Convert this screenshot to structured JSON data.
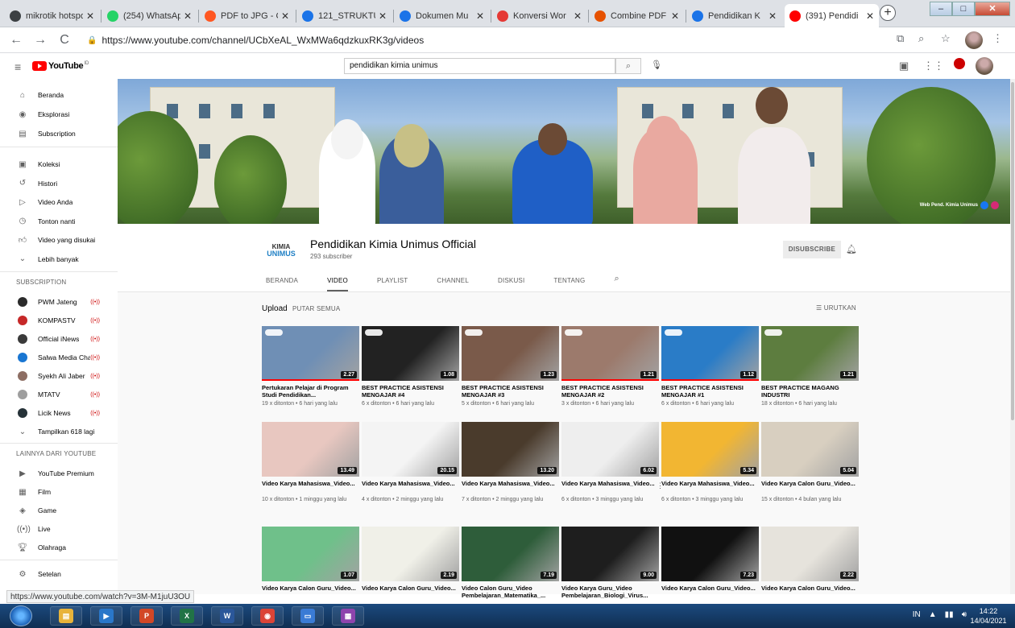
{
  "browser": {
    "tabs": [
      {
        "label": "mikrotik hotspot",
        "color": "#3c4043",
        "active": false
      },
      {
        "label": "(254) WhatsApp",
        "color": "#25d366",
        "active": false
      },
      {
        "label": "PDF to JPG - C",
        "color": "#ff5722",
        "active": false
      },
      {
        "label": "121_STRUKTUR",
        "color": "#1a73e8",
        "active": false
      },
      {
        "label": "Dokumen Mu",
        "color": "#1a73e8",
        "active": false
      },
      {
        "label": "Konversi Wor",
        "color": "#e53935",
        "active": false
      },
      {
        "label": "Combine PDF",
        "color": "#e65100",
        "active": false
      },
      {
        "label": "Pendidikan K",
        "color": "#1a73e8",
        "active": false
      },
      {
        "label": "(391) Pendidi",
        "color": "#ff0000",
        "active": true
      }
    ],
    "url": "https://www.youtube.com/channel/UCbXeAL_WxMWa6qdzkuxRK3g/videos",
    "status_url": "https://www.youtube.com/watch?v=3M-M1juU3OU"
  },
  "masthead": {
    "logo_text": "YouTube",
    "logo_region": "ID",
    "search_value": "pendidikan kimia unimus"
  },
  "sidebar": {
    "main": [
      "Beranda",
      "Eksplorasi",
      "Subscription"
    ],
    "library": [
      "Koleksi",
      "Histori",
      "Video Anda",
      "Tonton nanti",
      "Video yang disukai",
      "Lebih banyak"
    ],
    "subscription_title": "SUBSCRIPTION",
    "subscriptions": [
      {
        "name": "PWM Jateng",
        "color": "#2b2b2b"
      },
      {
        "name": "KOMPASTV",
        "color": "#c62828"
      },
      {
        "name": "Official iNews",
        "color": "#3a3a3a"
      },
      {
        "name": "Salwa Media Chan...",
        "color": "#1976d2"
      },
      {
        "name": "Syekh Ali Jaber",
        "color": "#8d6e63"
      },
      {
        "name": "MTATV",
        "color": "#9e9e9e"
      },
      {
        "name": "Licik News",
        "color": "#263238"
      }
    ],
    "show_more": "Tampilkan 618 lagi",
    "live_badge": "((•))",
    "more_title": "LAINNYA DARI YOUTUBE",
    "more": [
      "YouTube Premium",
      "Film",
      "Game",
      "Live",
      "Olahraga"
    ],
    "settings": "Setelan"
  },
  "banner": {
    "link_text": "Web Pend. Kimia Unimus"
  },
  "channel": {
    "logo_line1": "KIMIA",
    "logo_line2": "UNIMUS",
    "name": "Pendidikan Kimia Unimus Official",
    "subscribers": "293 subscriber",
    "unsubscribe_label": "DISUBSCRIBE",
    "tabs": [
      "BERANDA",
      "VIDEO",
      "PLAYLIST",
      "CHANNEL",
      "DISKUSI",
      "TENTANG"
    ],
    "selected_tab": "VIDEO"
  },
  "uploads": {
    "title": "Upload",
    "play_all": "PUTAR SEMUA",
    "sort": "URUTKAN",
    "videos": [
      {
        "title": "Pertukaran Pelajar di Program Studi Pendidikan...",
        "meta": "19 x ditonton • 6 hari yang lalu",
        "duration": "2.27",
        "bg": "#6f8fb5",
        "progress": 100
      },
      {
        "title": "BEST PRACTICE ASISTENSI MENGAJAR #4",
        "meta": "6 x ditonton • 6 hari yang lalu",
        "duration": "1.08",
        "bg": "#222222",
        "progress": 0
      },
      {
        "title": "BEST PRACTICE ASISTENSI MENGAJAR #3",
        "meta": "5 x ditonton • 6 hari yang lalu",
        "duration": "1.23",
        "bg": "#7a5a4a",
        "progress": 0
      },
      {
        "title": "BEST PRACTICE ASISTENSI MENGAJAR #2",
        "meta": "3 x ditonton • 6 hari yang lalu",
        "duration": "1.21",
        "bg": "#9c7a6c",
        "progress": 100
      },
      {
        "title": "BEST PRACTICE ASISTENSI MENGAJAR #1",
        "meta": "6 x ditonton • 6 hari yang lalu",
        "duration": "1.12",
        "bg": "#2a7cc7",
        "progress": 100
      },
      {
        "title": "BEST PRACTICE MAGANG INDUSTRI",
        "meta": "18 x ditonton • 6 hari yang lalu",
        "duration": "1.21",
        "bg": "#5d7d3f",
        "progress": 0
      },
      {
        "title": "Video Karya Mahasiswa_Video...",
        "meta": "10 x ditonton • 1 minggu yang lalu",
        "duration": "13.49",
        "bg": "#e8c7c0",
        "progress": 0
      },
      {
        "title": "Video Karya Mahasiswa_Video...",
        "meta": "4 x ditonton • 2 minggu yang lalu",
        "duration": "20.15",
        "bg": "#f4f4f4",
        "progress": 0
      },
      {
        "title": "Video Karya Mahasiswa_Video...",
        "meta": "7 x ditonton • 2 minggu yang lalu",
        "duration": "13.20",
        "bg": "#4a3b2c",
        "progress": 0
      },
      {
        "title": "Video Karya Mahasiswa_Video...",
        "meta": "6 x ditonton • 3 minggu yang lalu",
        "duration": "6.02",
        "bg": "#eeeeee",
        "progress": 0
      },
      {
        "title": "Video Karya Mahasiswa_Video...",
        "meta": "6 x ditonton • 3 minggu yang lalu",
        "duration": "5.34",
        "bg": "#f2b632",
        "progress": 0
      },
      {
        "title": "Video Karya Calon Guru_Video...",
        "meta": "15 x ditonton • 4 bulan yang lalu",
        "duration": "5.04",
        "bg": "#d8cfc0",
        "progress": 0
      },
      {
        "title": "Video Karya Calon Guru_Video...",
        "meta": "",
        "duration": "1.07",
        "bg": "#6fc08a",
        "progress": 0
      },
      {
        "title": "Video Karya Calon Guru_Video...",
        "meta": "",
        "duration": "2.19",
        "bg": "#f0f0e8",
        "progress": 0
      },
      {
        "title": "Video Calon Guru_Video Pembelajaran_Matematika_...",
        "meta": "",
        "duration": "7.19",
        "bg": "#2e5d3a",
        "progress": 0
      },
      {
        "title": "Video Karya Guru_Video Pembelajaran_Biologi_Virus...",
        "meta": "",
        "duration": "9.00",
        "bg": "#1e1e1e",
        "progress": 0
      },
      {
        "title": "Video Karya Calon Guru_Video...",
        "meta": "",
        "duration": "7.23",
        "bg": "#111111",
        "progress": 0
      },
      {
        "title": "Video Karya Calon Guru_Video...",
        "meta": "",
        "duration": "2.22",
        "bg": "#e6e3dc",
        "progress": 0
      }
    ]
  },
  "taskbar": {
    "apps": [
      {
        "name": "explorer",
        "glyph": "▤",
        "color": "#e8b33a"
      },
      {
        "name": "media",
        "glyph": "▶",
        "color": "#2a77c9"
      },
      {
        "name": "powerpoint",
        "glyph": "P",
        "color": "#d24726"
      },
      {
        "name": "excel",
        "glyph": "X",
        "color": "#217346"
      },
      {
        "name": "word",
        "glyph": "W",
        "color": "#2b579a"
      },
      {
        "name": "chrome",
        "glyph": "◉",
        "color": "#db4437"
      },
      {
        "name": "screen",
        "glyph": "▭",
        "color": "#3a7bd5"
      },
      {
        "name": "winrar",
        "glyph": "▦",
        "color": "#8e44ad"
      }
    ],
    "language": "IN",
    "time": "14:22",
    "date": "14/04/2021"
  }
}
